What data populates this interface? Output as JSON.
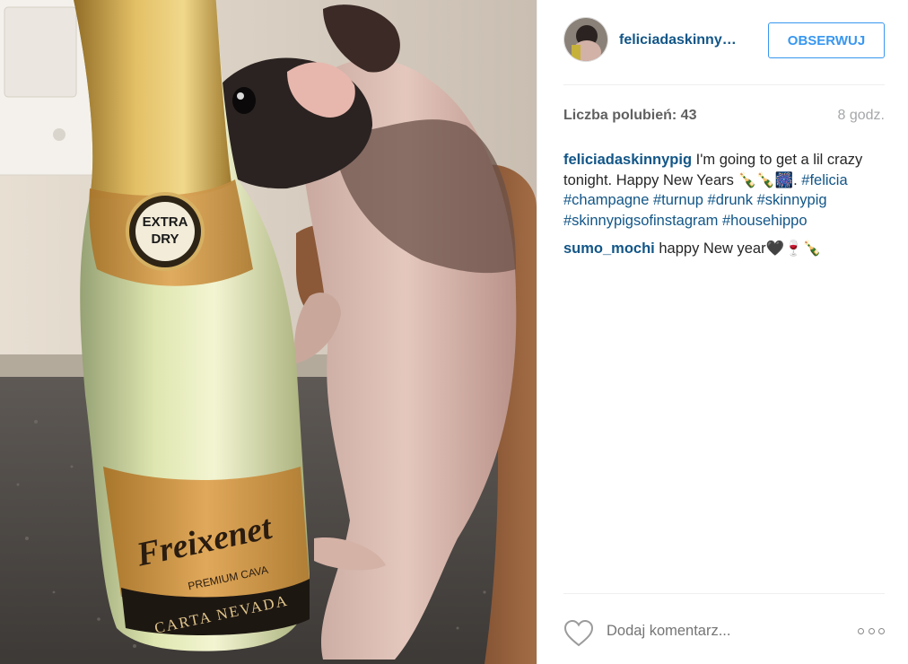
{
  "post": {
    "username": "feliciadaskinny…",
    "follow_label": "OBSERWUJ",
    "likes_label": "Liczba polubień:",
    "likes_count": "43",
    "time_ago": "8 godz.",
    "caption": {
      "user": "feliciadaskinnypig",
      "text": "I'm going to get a lil crazy tonight. Happy New Years 🍾🍾🎆.",
      "hashtags": "#felicia #champagne #turnup #drunk #skinnypig #skinnypigsofinstagram #househippo"
    },
    "comments": [
      {
        "user": "sumo_mochi",
        "text": "happy New year🖤🍷🍾"
      }
    ],
    "comment_placeholder": "Dodaj komentarz..."
  },
  "photo": {
    "bottle_badge": "EXTRA DRY",
    "bottle_brand": "Freixenet",
    "bottle_sub": "PREMIUM CAVA",
    "bottle_line": "CARTA NEVADA"
  }
}
